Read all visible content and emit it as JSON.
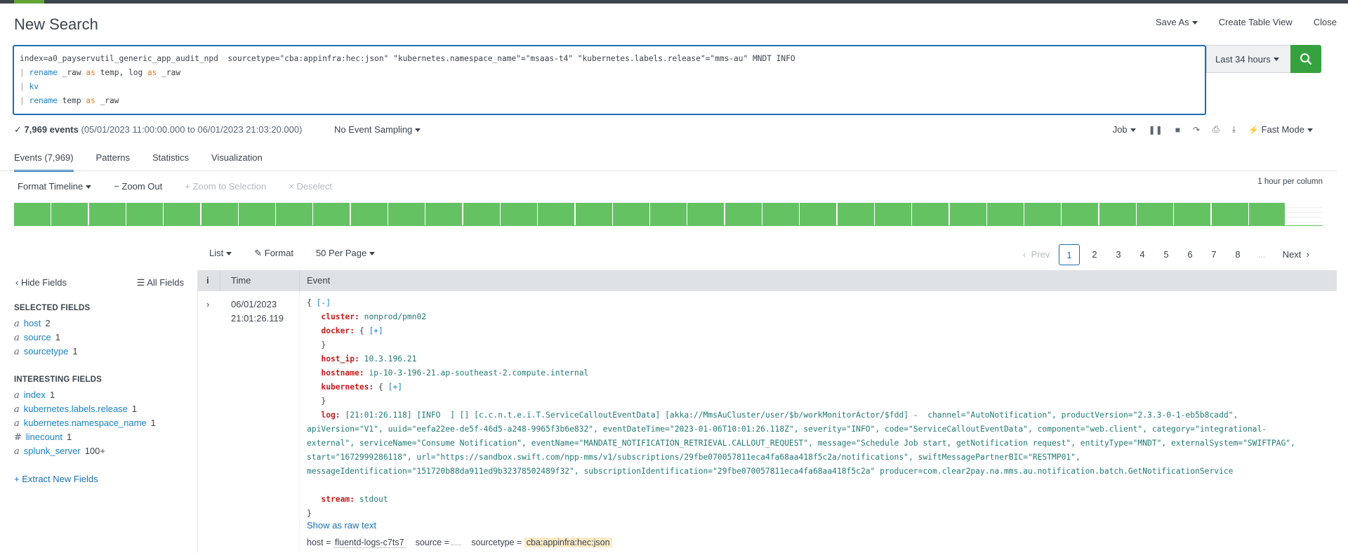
{
  "header": {
    "title": "New Search",
    "actions": [
      "Save As",
      "Create Table View",
      "Close"
    ]
  },
  "search": {
    "line1": "index=a0_payservutil_generic_app_audit_npd  sourcetype=\"cba:appinfra:hec:json\" \"kubernetes.namespace_name\"=\"msaas-t4\" \"kubernetes.labels.release\"=\"mms-au\" MNDT INFO",
    "line2_cmd": "rename",
    "line2_a": " _raw ",
    "line2_as1": "as",
    "line2_b": " temp, log ",
    "line2_as2": "as",
    "line2_c": " _raw",
    "line3_cmd": "kv",
    "line4_cmd": "rename",
    "line4_a": " temp ",
    "line4_as": "as",
    "line4_b": " _raw",
    "pipe": "|",
    "time_range": "Last 34 hours"
  },
  "status": {
    "check": "✓",
    "count": "7,969 events",
    "range": "(05/01/2023 11:00:00.000 to 06/01/2023 21:03:20.000)",
    "sampling": "No Event Sampling",
    "job": "Job",
    "mode": "Fast Mode"
  },
  "tabs": [
    "Events (7,969)",
    "Patterns",
    "Statistics",
    "Visualization"
  ],
  "timeline": {
    "format": "Format Timeline",
    "zoom_out": "Zoom Out",
    "zoom_sel": "Zoom to Selection",
    "deselect": "Deselect",
    "scale": "1 hour per column",
    "bar_color": "#65c263",
    "columns": 34
  },
  "results_bar": {
    "list": "List",
    "format": "Format",
    "per_page": "50 Per Page",
    "prev": "Prev",
    "pages": [
      "1",
      "2",
      "3",
      "4",
      "5",
      "6",
      "7",
      "8",
      "..."
    ],
    "next": "Next"
  },
  "sidebar": {
    "hide": "Hide Fields",
    "all": "All Fields",
    "selected_heading": "SELECTED FIELDS",
    "selected": [
      {
        "type": "a",
        "name": "host",
        "count": "2"
      },
      {
        "type": "a",
        "name": "source",
        "count": "1"
      },
      {
        "type": "a",
        "name": "sourcetype",
        "count": "1"
      }
    ],
    "interesting_heading": "INTERESTING FIELDS",
    "interesting": [
      {
        "type": "a",
        "name": "index",
        "count": "1"
      },
      {
        "type": "a",
        "name": "kubernetes.labels.release",
        "count": "1"
      },
      {
        "type": "a",
        "name": "kubernetes.namespace_name",
        "count": "1"
      },
      {
        "type": "#",
        "name": "linecount",
        "count": "1"
      },
      {
        "type": "a",
        "name": "splunk_server",
        "count": "100+"
      }
    ],
    "extract": "+ Extract New Fields"
  },
  "table": {
    "col_i": "i",
    "col_time": "Time",
    "col_event": "Event",
    "row_date": "06/01/2023",
    "row_time": "21:01:26.119"
  },
  "event": {
    "open": "{",
    "collapse": "[-]",
    "expand": "[+]",
    "close": "}",
    "cluster_k": "cluster:",
    "cluster_v": "nonprod/pmn02",
    "docker_k": "docker:",
    "host_ip_k": "host_ip:",
    "host_ip_v": "10.3.196.21",
    "hostname_k": "hostname:",
    "hostname_v": "ip-10-3-196-21.ap-southeast-2.compute.internal",
    "kubernetes_k": "kubernetes:",
    "log_k": "log:",
    "log_1": "[21:01:26.118] [INFO  ] [] [c.c.n.t.e.i.T.ServiceCalloutEventData] [akka://MmsAuCluster/user/$b/workMonitorActor/$fdd] -  channel=\"AutoNotification\", productVersion=\"2.3.3-0-1-eb5b8cadd\",",
    "log_2": "apiVersion=\"V1\", uuid=\"eefa22ee-de5f-46d5-a248-9965f3b6e832\", eventDateTime=\"2023-01-06T10:01:26.118Z\", severity=\"INFO\", code=\"ServiceCalloutEventData\", component=\"web.client\", category=\"integrational-",
    "log_3": "external\", serviceName=\"Consume Notification\", eventName=\"MANDATE_NOTIFICATION_RETRIEVAL.CALLOUT_REQUEST\", message=\"Schedule Job start, getNotification request\", entityType=\"MNDT\", externalSystem=\"SWIFTPAG\",",
    "log_4": "start=\"1672999286118\", url=\"https://sandbox.swift.com/npp-mms/v1/subscriptions/29fbe070057811eca4fa68aa418f5c2a/notifications\", swiftMessagePartnerBIC=\"RESTMP01\",",
    "log_5": "messageIdentification=\"151720b88da911ed9b32378502489f32\", subscriptionIdentification=\"29fbe070057811eca4fa68aa418f5c2a\" producer=com.clear2pay.na.mms.au.notification.batch.GetNotificationService",
    "stream_k": "stream:",
    "stream_v": "stdout",
    "raw_link": "Show as raw text",
    "host_label": "host =",
    "host_val": "fluentd-logs-c7ts7",
    "source_label": "source =",
    "sourcetype_label": "sourcetype =",
    "sourcetype_val": "cba:appinfra:hec:json"
  }
}
